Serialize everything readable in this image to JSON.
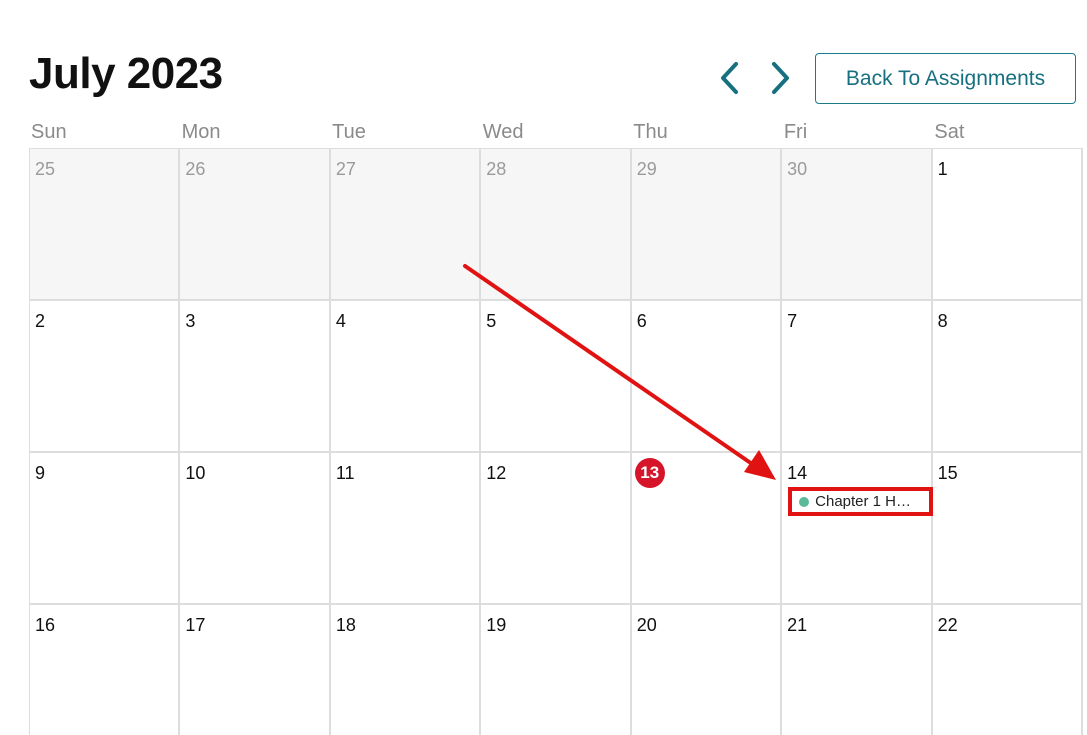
{
  "header": {
    "title": "July 2023",
    "prev_icon": "chevron-left-icon",
    "next_icon": "chevron-right-icon",
    "back_label": "Back To Assignments"
  },
  "weekdays": [
    "Sun",
    "Mon",
    "Tue",
    "Wed",
    "Thu",
    "Fri",
    "Sat"
  ],
  "weeks": [
    [
      "25",
      "26",
      "27",
      "28",
      "29",
      "30",
      "1"
    ],
    [
      "2",
      "3",
      "4",
      "5",
      "6",
      "7",
      "8"
    ],
    [
      "9",
      "10",
      "11",
      "12",
      "13",
      "14",
      "15"
    ],
    [
      "16",
      "17",
      "18",
      "19",
      "20",
      "21",
      "22"
    ]
  ],
  "today": "13",
  "event": {
    "day": "14",
    "label": "Chapter 1 H…"
  },
  "colors": {
    "accent": "#17707f",
    "today": "#d6152b",
    "event_dot": "#5bb89a",
    "annotation": "#e01212"
  }
}
